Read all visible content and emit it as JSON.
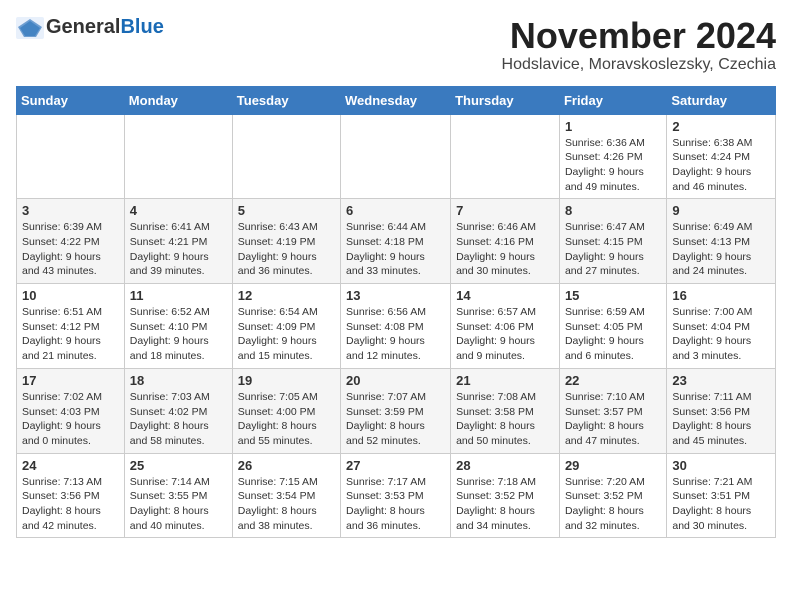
{
  "header": {
    "logo_general": "General",
    "logo_blue": "Blue",
    "month_title": "November 2024",
    "location": "Hodslavice, Moravskoslezsky, Czechia"
  },
  "days_of_week": [
    "Sunday",
    "Monday",
    "Tuesday",
    "Wednesday",
    "Thursday",
    "Friday",
    "Saturday"
  ],
  "weeks": [
    [
      {
        "day": "",
        "info": ""
      },
      {
        "day": "",
        "info": ""
      },
      {
        "day": "",
        "info": ""
      },
      {
        "day": "",
        "info": ""
      },
      {
        "day": "",
        "info": ""
      },
      {
        "day": "1",
        "info": "Sunrise: 6:36 AM\nSunset: 4:26 PM\nDaylight: 9 hours and 49 minutes."
      },
      {
        "day": "2",
        "info": "Sunrise: 6:38 AM\nSunset: 4:24 PM\nDaylight: 9 hours and 46 minutes."
      }
    ],
    [
      {
        "day": "3",
        "info": "Sunrise: 6:39 AM\nSunset: 4:22 PM\nDaylight: 9 hours and 43 minutes."
      },
      {
        "day": "4",
        "info": "Sunrise: 6:41 AM\nSunset: 4:21 PM\nDaylight: 9 hours and 39 minutes."
      },
      {
        "day": "5",
        "info": "Sunrise: 6:43 AM\nSunset: 4:19 PM\nDaylight: 9 hours and 36 minutes."
      },
      {
        "day": "6",
        "info": "Sunrise: 6:44 AM\nSunset: 4:18 PM\nDaylight: 9 hours and 33 minutes."
      },
      {
        "day": "7",
        "info": "Sunrise: 6:46 AM\nSunset: 4:16 PM\nDaylight: 9 hours and 30 minutes."
      },
      {
        "day": "8",
        "info": "Sunrise: 6:47 AM\nSunset: 4:15 PM\nDaylight: 9 hours and 27 minutes."
      },
      {
        "day": "9",
        "info": "Sunrise: 6:49 AM\nSunset: 4:13 PM\nDaylight: 9 hours and 24 minutes."
      }
    ],
    [
      {
        "day": "10",
        "info": "Sunrise: 6:51 AM\nSunset: 4:12 PM\nDaylight: 9 hours and 21 minutes."
      },
      {
        "day": "11",
        "info": "Sunrise: 6:52 AM\nSunset: 4:10 PM\nDaylight: 9 hours and 18 minutes."
      },
      {
        "day": "12",
        "info": "Sunrise: 6:54 AM\nSunset: 4:09 PM\nDaylight: 9 hours and 15 minutes."
      },
      {
        "day": "13",
        "info": "Sunrise: 6:56 AM\nSunset: 4:08 PM\nDaylight: 9 hours and 12 minutes."
      },
      {
        "day": "14",
        "info": "Sunrise: 6:57 AM\nSunset: 4:06 PM\nDaylight: 9 hours and 9 minutes."
      },
      {
        "day": "15",
        "info": "Sunrise: 6:59 AM\nSunset: 4:05 PM\nDaylight: 9 hours and 6 minutes."
      },
      {
        "day": "16",
        "info": "Sunrise: 7:00 AM\nSunset: 4:04 PM\nDaylight: 9 hours and 3 minutes."
      }
    ],
    [
      {
        "day": "17",
        "info": "Sunrise: 7:02 AM\nSunset: 4:03 PM\nDaylight: 9 hours and 0 minutes."
      },
      {
        "day": "18",
        "info": "Sunrise: 7:03 AM\nSunset: 4:02 PM\nDaylight: 8 hours and 58 minutes."
      },
      {
        "day": "19",
        "info": "Sunrise: 7:05 AM\nSunset: 4:00 PM\nDaylight: 8 hours and 55 minutes."
      },
      {
        "day": "20",
        "info": "Sunrise: 7:07 AM\nSunset: 3:59 PM\nDaylight: 8 hours and 52 minutes."
      },
      {
        "day": "21",
        "info": "Sunrise: 7:08 AM\nSunset: 3:58 PM\nDaylight: 8 hours and 50 minutes."
      },
      {
        "day": "22",
        "info": "Sunrise: 7:10 AM\nSunset: 3:57 PM\nDaylight: 8 hours and 47 minutes."
      },
      {
        "day": "23",
        "info": "Sunrise: 7:11 AM\nSunset: 3:56 PM\nDaylight: 8 hours and 45 minutes."
      }
    ],
    [
      {
        "day": "24",
        "info": "Sunrise: 7:13 AM\nSunset: 3:56 PM\nDaylight: 8 hours and 42 minutes."
      },
      {
        "day": "25",
        "info": "Sunrise: 7:14 AM\nSunset: 3:55 PM\nDaylight: 8 hours and 40 minutes."
      },
      {
        "day": "26",
        "info": "Sunrise: 7:15 AM\nSunset: 3:54 PM\nDaylight: 8 hours and 38 minutes."
      },
      {
        "day": "27",
        "info": "Sunrise: 7:17 AM\nSunset: 3:53 PM\nDaylight: 8 hours and 36 minutes."
      },
      {
        "day": "28",
        "info": "Sunrise: 7:18 AM\nSunset: 3:52 PM\nDaylight: 8 hours and 34 minutes."
      },
      {
        "day": "29",
        "info": "Sunrise: 7:20 AM\nSunset: 3:52 PM\nDaylight: 8 hours and 32 minutes."
      },
      {
        "day": "30",
        "info": "Sunrise: 7:21 AM\nSunset: 3:51 PM\nDaylight: 8 hours and 30 minutes."
      }
    ]
  ]
}
